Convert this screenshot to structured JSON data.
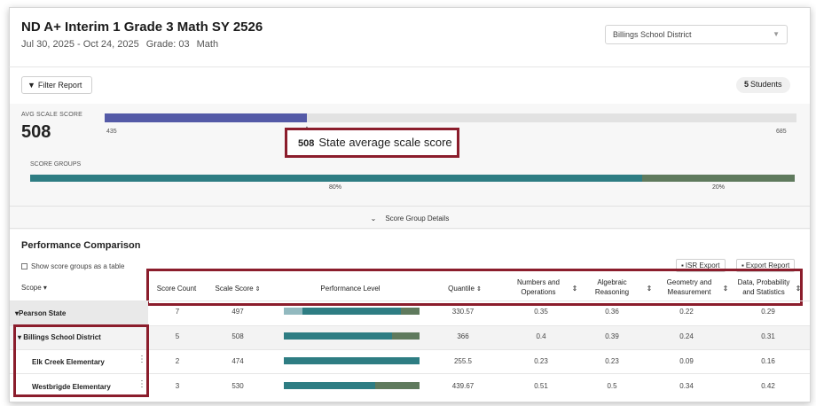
{
  "header": {
    "title": "ND A+ Interim 1 Grade 3 Math SY 2526",
    "date_range": "Jul 30, 2025 - Oct 24, 2025",
    "grade": "Grade: 03",
    "subject": "Math",
    "district_select": "Billings School District"
  },
  "toolbar": {
    "filter_label": "Filter Report",
    "student_count": "5",
    "students_label": "Students"
  },
  "summary": {
    "avg_label": "AVG SCALE SCORE",
    "avg_value": "508",
    "range_min": "435",
    "range_max": "685",
    "avg_fraction": 0.292,
    "callout_value": "508",
    "callout_text": "State average scale score",
    "score_groups_label": "SCORE GROUPS",
    "score_groups": [
      {
        "pct_label": "80%",
        "fraction": 0.8,
        "color": "#2e7d83"
      },
      {
        "pct_label": "20%",
        "fraction": 0.2,
        "color": "#5f7a5d"
      }
    ],
    "details_label": "Score Group Details"
  },
  "performance": {
    "title": "Performance Comparison",
    "show_table_label": "Show score groups as a table",
    "isr_export": "ISR Export",
    "export_report": "Export Report",
    "scope_header": "Scope",
    "columns": {
      "score_count": "Score Count",
      "scale_score": "Scale Score",
      "perf_level": "Performance Level",
      "quantile": "Quantile",
      "numbers_ops_1": "Numbers and",
      "numbers_ops_2": "Operations",
      "algebraic_1": "Algebraic",
      "algebraic_2": "Reasoning",
      "geometry_1": "Geometry and",
      "geometry_2": "Measurement",
      "data_1": "Data, Probability",
      "data_2": "and Statistics"
    },
    "rows": [
      {
        "scope": "Pearson State",
        "score_count": "7",
        "scale_score": "497",
        "quantile": "330.57",
        "numbers_ops": "0.35",
        "algebraic": "0.36",
        "geometry": "0.22",
        "data": "0.29",
        "levels": [
          0.14,
          0.72,
          0.14
        ]
      },
      {
        "scope": "Billings School District",
        "score_count": "5",
        "scale_score": "508",
        "quantile": "366",
        "numbers_ops": "0.4",
        "algebraic": "0.39",
        "geometry": "0.24",
        "data": "0.31",
        "levels": [
          0,
          0.8,
          0.2
        ]
      },
      {
        "scope": "Elk Creek Elementary",
        "score_count": "2",
        "scale_score": "474",
        "quantile": "255.5",
        "numbers_ops": "0.23",
        "algebraic": "0.23",
        "geometry": "0.09",
        "data": "0.16",
        "levels": [
          0,
          1.0,
          0
        ]
      },
      {
        "scope": "Westbrigde Elementary",
        "score_count": "3",
        "scale_score": "530",
        "quantile": "439.67",
        "numbers_ops": "0.51",
        "algebraic": "0.5",
        "geometry": "0.34",
        "data": "0.42",
        "levels": [
          0,
          0.67,
          0.33
        ]
      }
    ]
  },
  "colors": {
    "accent_purple": "#545aa7",
    "teal": "#2e7d83",
    "green": "#5f7a5d",
    "light_teal": "#92b9bf",
    "highlight_box": "#8b1d2c"
  }
}
